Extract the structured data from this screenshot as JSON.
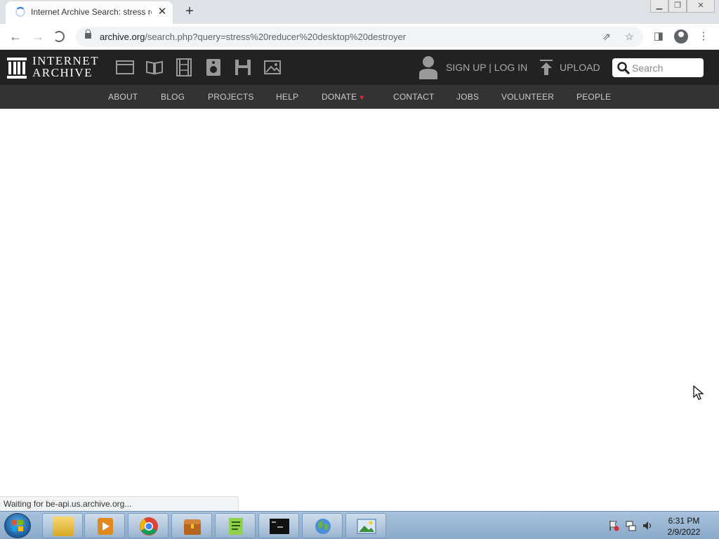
{
  "browser": {
    "tab_title": "Internet Archive Search: stress re",
    "url_host": "archive.org",
    "url_path": "/search.php?query=stress%20reducer%20desktop%20destroyer",
    "status_text": "Waiting for be-api.us.archive.org..."
  },
  "header": {
    "logo_line1": "INTERNET",
    "logo_line2": "ARCHIVE",
    "signup_label": "SIGN UP | LOG IN",
    "upload_label": "UPLOAD",
    "search_placeholder": "Search"
  },
  "nav": {
    "items": [
      "ABOUT",
      "BLOG",
      "PROJECTS",
      "HELP",
      "DONATE",
      "CONTACT",
      "JOBS",
      "VOLUNTEER",
      "PEOPLE"
    ]
  },
  "taskbar": {
    "time": "6:31 PM",
    "date": "2/9/2022"
  },
  "colors": {
    "header_bg": "#222222",
    "subnav_bg": "#333333",
    "donate_heart": "#e03131",
    "accent": "#1a73e8"
  }
}
